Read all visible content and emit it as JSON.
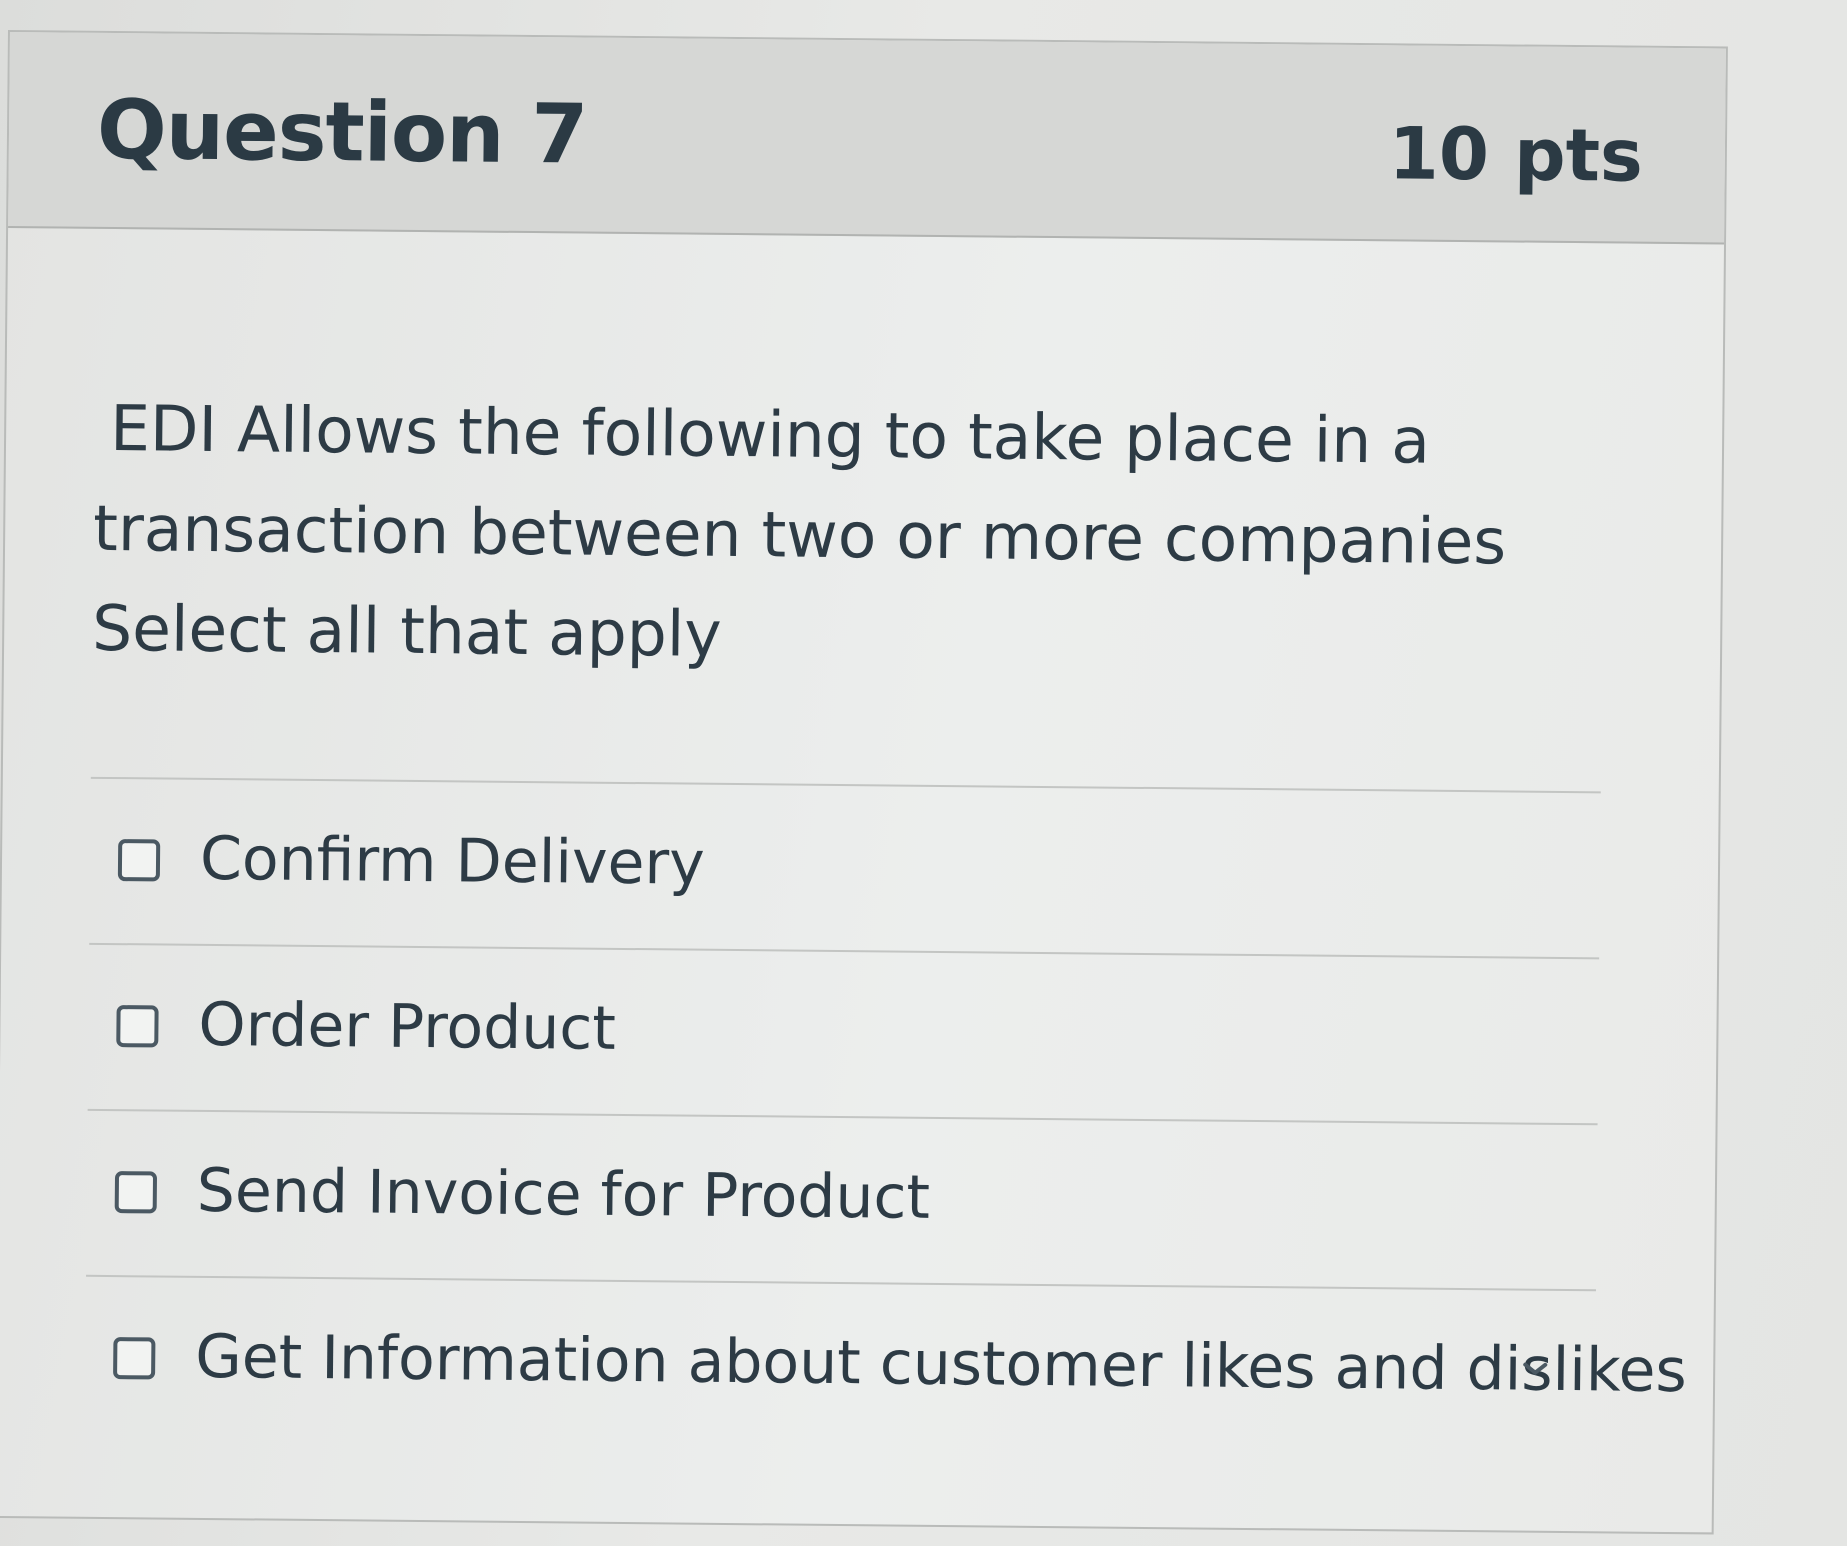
{
  "question": {
    "title": "Question 7",
    "points": "10 pts",
    "text_lines": [
      "EDI Allows the following to take place in a",
      "transaction between two or more companies",
      "Select all that apply"
    ]
  },
  "answers": [
    {
      "label": "Confirm Delivery",
      "checked": false
    },
    {
      "label": "Order Product",
      "checked": false
    },
    {
      "label": "Send Invoice for Product",
      "checked": false
    },
    {
      "label": "Get Information about customer likes and dislikes",
      "checked": false
    }
  ],
  "icons": {
    "checkbox": "empty-checkbox-icon",
    "chevron": "chevron-down-icon"
  }
}
